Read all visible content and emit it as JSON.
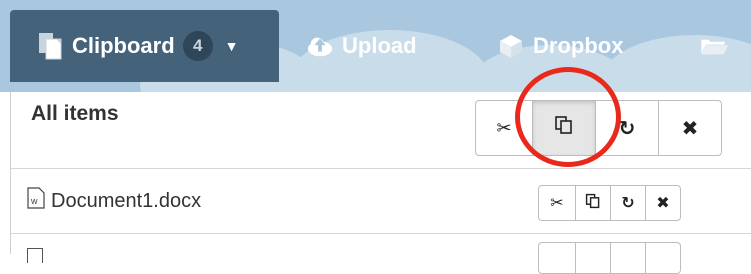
{
  "toolbar": {
    "clipboard_label": "Clipboard",
    "clipboard_count": "4",
    "upload_label": "Upload",
    "dropbox_label": "Dropbox",
    "icons": [
      "clipboard-icon",
      "chevron-down-icon",
      "cloud-upload-icon",
      "dropbox-icon",
      "folder-icon"
    ]
  },
  "panel": {
    "header": "All items",
    "header_actions": [
      "cut",
      "copy",
      "move",
      "remove"
    ],
    "items": [
      {
        "name": "Document1.docx",
        "icon": "word-file-icon",
        "actions": [
          "cut",
          "copy",
          "move",
          "remove"
        ]
      }
    ]
  },
  "annotation": {
    "color": "#e8291c",
    "target": "copy-all-button"
  },
  "colors": {
    "toolbar_bg": "#a9c8e0",
    "active_tab_bg": "#45627b",
    "badge_bg": "#2f4558"
  }
}
